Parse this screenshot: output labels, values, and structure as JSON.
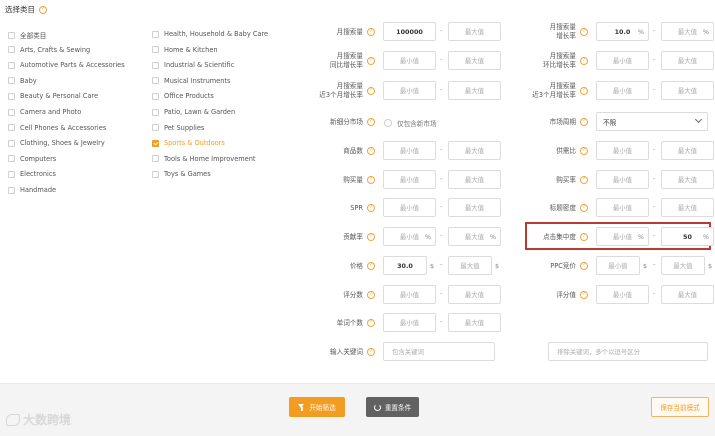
{
  "categories": {
    "title": "选择类目",
    "left": [
      {
        "label": "全部类目",
        "checked": false
      },
      {
        "label": "Arts, Crafts & Sewing",
        "checked": false
      },
      {
        "label": "Automotive Parts & Accessories",
        "checked": false
      },
      {
        "label": "Baby",
        "checked": false
      },
      {
        "label": "Beauty & Personal Care",
        "checked": false
      },
      {
        "label": "Camera and Photo",
        "checked": false
      },
      {
        "label": "Cell Phones & Accessories",
        "checked": false
      },
      {
        "label": "Clothing, Shoes & Jewelry",
        "checked": false
      },
      {
        "label": "Computers",
        "checked": false
      },
      {
        "label": "Electronics",
        "checked": false
      },
      {
        "label": "Handmade",
        "checked": false
      }
    ],
    "right": [
      {
        "label": "Health, Household & Baby Care",
        "checked": false
      },
      {
        "label": "Home & Kitchen",
        "checked": false
      },
      {
        "label": "Industrial & Scientific",
        "checked": false
      },
      {
        "label": "Musical Instruments",
        "checked": false
      },
      {
        "label": "Office Products",
        "checked": false
      },
      {
        "label": "Patio, Lawn & Garden",
        "checked": false
      },
      {
        "label": "Pet Supplies",
        "checked": false
      },
      {
        "label": "Sports & Outdoors",
        "checked": true
      },
      {
        "label": "Tools & Home Improvement",
        "checked": false
      },
      {
        "label": "Toys & Games",
        "checked": false
      }
    ]
  },
  "placeholders": {
    "min": "最小值",
    "max": "最大值"
  },
  "filters": {
    "monthly_search": {
      "label": "月搜索量",
      "min": "100000",
      "max": ""
    },
    "monthly_search_growth": {
      "label": "月搜索量\n增长率",
      "min": "10.0",
      "max": "",
      "unit": "%"
    },
    "monthly_search_yoy": {
      "label": "月搜索量\n同比增长率",
      "min": "",
      "max": ""
    },
    "monthly_search_mom": {
      "label": "月搜索量\n环比增长率",
      "min": "",
      "max": ""
    },
    "search_3m_growth_left": {
      "label": "月搜索量\n近3个月增长率",
      "min": "",
      "max": ""
    },
    "search_3m_growth_right": {
      "label": "月搜索量\n近3个月增长率",
      "min": "",
      "max": ""
    },
    "niche_market": {
      "label": "新细分市场",
      "radio_label": "仅包含新市场"
    },
    "market_cycle": {
      "label": "市场周期",
      "value": "不限"
    },
    "product_count": {
      "label": "商品数",
      "min": "",
      "max": ""
    },
    "supply_demand": {
      "label": "供需比",
      "min": "",
      "max": ""
    },
    "purchase_volume": {
      "label": "购买量",
      "min": "",
      "max": ""
    },
    "purchase_rate": {
      "label": "购买率",
      "min": "",
      "max": ""
    },
    "spr": {
      "label": "SPR",
      "min": "",
      "max": ""
    },
    "title_density": {
      "label": "标题密度",
      "min": "",
      "max": ""
    },
    "ad_share": {
      "label": "贡献率",
      "min": "",
      "max": "",
      "unit": "%"
    },
    "click_concentration": {
      "label": "点击集中度",
      "min": "",
      "max": "50",
      "unit": "%"
    },
    "price": {
      "label": "价格",
      "min": "30.0",
      "max": "",
      "unit": "$"
    },
    "ppc_bid": {
      "label": "PPC竞价",
      "min": "",
      "max": "",
      "unit": "$"
    },
    "review_count": {
      "label": "评分数",
      "min": "",
      "max": ""
    },
    "rating": {
      "label": "评分值",
      "min": "",
      "max": ""
    },
    "word_count": {
      "label": "单词个数",
      "min": "",
      "max": ""
    },
    "keywords": {
      "label": "输入关键词",
      "include_placeholder": "包含关键词",
      "exclude_placeholder": "排除关键词，多个以逗号区分"
    }
  },
  "dash": "-",
  "actions": {
    "start": "开始筛选",
    "reset": "重置条件",
    "save": "保存当前模式"
  },
  "watermark": "大数跨境",
  "colors": {
    "accent": "#f39c22",
    "highlight": "#b83a32"
  }
}
